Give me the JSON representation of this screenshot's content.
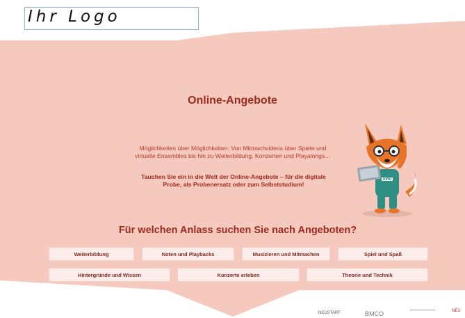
{
  "header": {
    "logo_text": "Ihr Logo"
  },
  "main": {
    "title": "Online-Angebote",
    "intro": "Möglichkeiten über Möglichkeiten: Von Mitmachvideos über Spiele und virtuelle Ensembles bis hin zu Weiterbildung, Konzerten und Playalongs…",
    "cta": "Tauchen Sie ein in die Welt der Online-Angebote – für die digitale Probe, als Probenersatz oder zum Selbststudium!",
    "mascot_label": "AMU",
    "question": "Für welchen Anlass suchen Sie nach Angeboten?",
    "buttons": [
      "Weiterbildung",
      "Noten und Playbacks",
      "Musizieren und Mitmachen",
      "Spiel und Spaß",
      "Hintergründe und Wissen",
      "Konzerte erleben",
      "Theorie und Technik"
    ]
  },
  "footer": {
    "logos": [
      "NEUSTART",
      "BMCO",
      "NEU"
    ]
  },
  "colors": {
    "band": "#f6c9bf",
    "heading": "#9b2a1c",
    "button_bg": "#fcecea"
  }
}
